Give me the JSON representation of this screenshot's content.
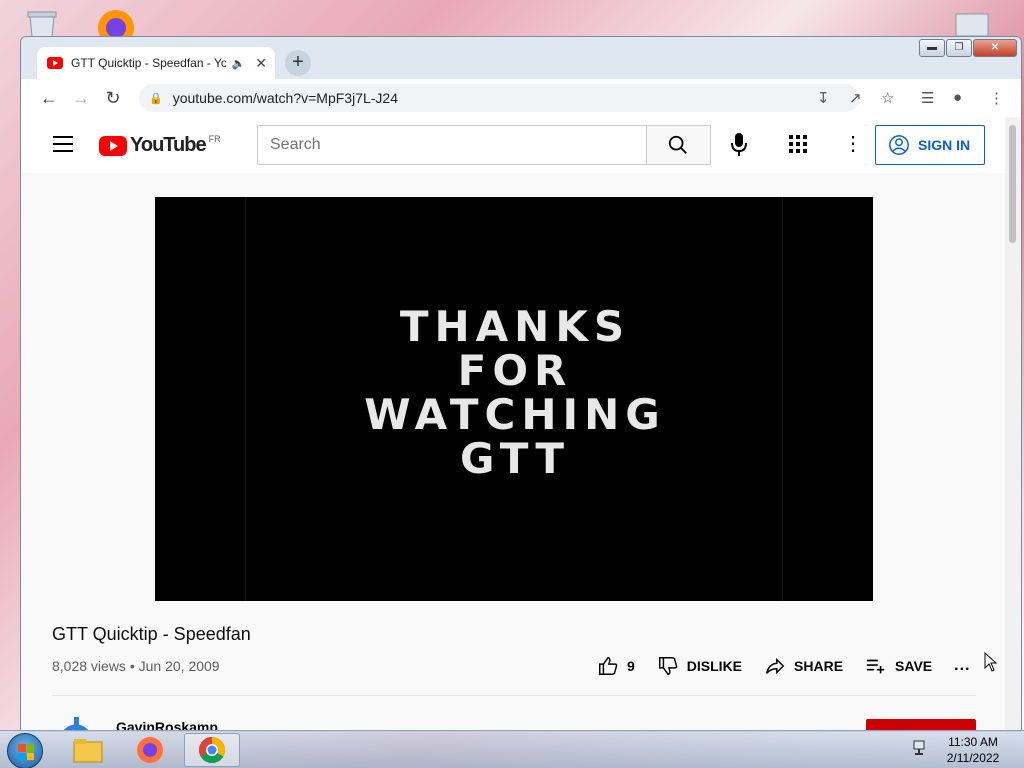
{
  "browser": {
    "tab_title": "GTT Quicktip - Speedfan - YouTube",
    "url": "youtube.com/watch?v=MpF3j7L-J24",
    "new_tab_label": "+",
    "close_tab_label": "✕",
    "window_minimize": "▬",
    "window_maximize": "❐",
    "window_close": "✕"
  },
  "youtube": {
    "logo_text": "YouTube",
    "country_code": "FR",
    "search_placeholder": "Search",
    "sign_in_label": "SIGN IN",
    "video_frame_text": [
      "THANKS",
      "FOR",
      "WATCHING",
      "GTT"
    ],
    "video_title": "GTT Quicktip - Speedfan",
    "views": "8,028 views",
    "date_separator": "•",
    "upload_date": "Jun 20, 2009",
    "actions": {
      "like_count": "9",
      "dislike_label": "DISLIKE",
      "share_label": "SHARE",
      "save_label": "SAVE",
      "more_label": "..."
    },
    "channel_name": "GavinRoskamp"
  },
  "taskbar": {
    "time": "11:30 AM",
    "date": "2/11/2022",
    "apps": [
      "file-explorer-icon",
      "firefox-icon",
      "chrome-icon"
    ]
  },
  "colors": {
    "youtube_red": "#ff0000",
    "link_blue": "#065fd4",
    "subscribe_red": "#cc0000"
  }
}
